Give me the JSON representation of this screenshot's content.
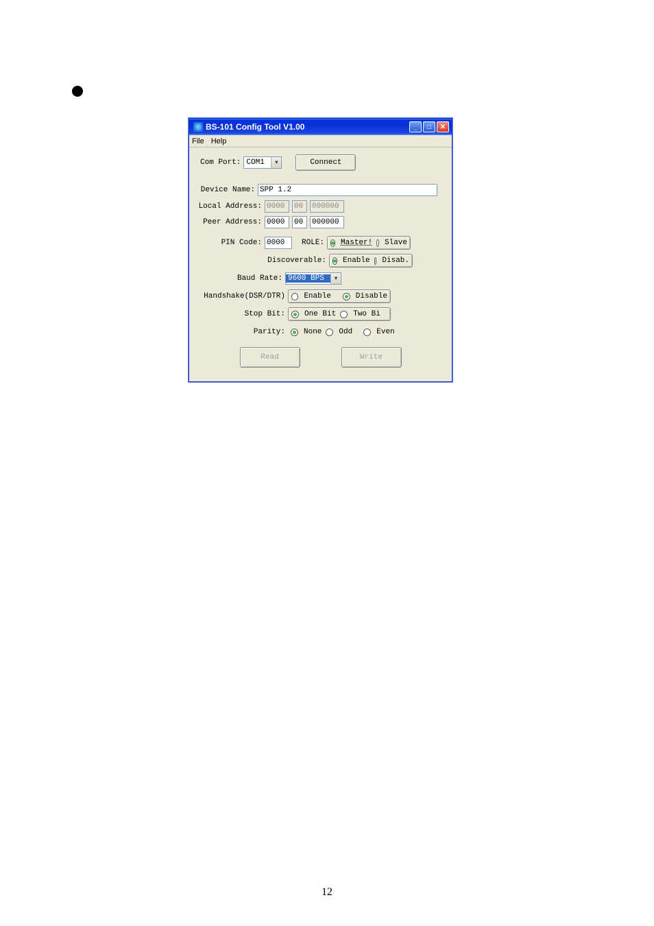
{
  "page_number": "12",
  "window": {
    "title": "BS-101 Config Tool V1.00",
    "menu": {
      "file": "File",
      "help": "Help"
    },
    "buttons": {
      "connect": "Connect",
      "read": "Read",
      "write": "Write"
    },
    "labels": {
      "com_port": "Com Port:",
      "device_name": "Device Name:",
      "local_addr": "Local Address:",
      "peer_addr": "Peer Address:",
      "pin_code": "PIN Code:",
      "role": "ROLE:",
      "discoverable": "Discoverable:",
      "baud_rate": "Baud Rate:",
      "handshake": "Handshake(DSR/DTR)",
      "stop_bit": "Stop Bit:",
      "parity": "Parity:"
    },
    "values": {
      "com_port": "COM1",
      "device_name": "SPP 1.2",
      "local_a": "0000",
      "local_b": "00",
      "local_c": "000000",
      "peer_a": "0000",
      "peer_b": "00",
      "peer_c": "000000",
      "pin_code": "0000",
      "baud_rate": "9600 BPS"
    },
    "options": {
      "role": {
        "master": "Master!",
        "slave": "Slave"
      },
      "discoverable": {
        "enable": "Enable",
        "disable": "Disab."
      },
      "handshake": {
        "enable": "Enable",
        "disable": "Disable"
      },
      "stop_bit": {
        "one": "One Bit",
        "two": "Two Bi"
      },
      "parity": {
        "none": "None",
        "odd": "Odd",
        "even": "Even"
      }
    }
  }
}
